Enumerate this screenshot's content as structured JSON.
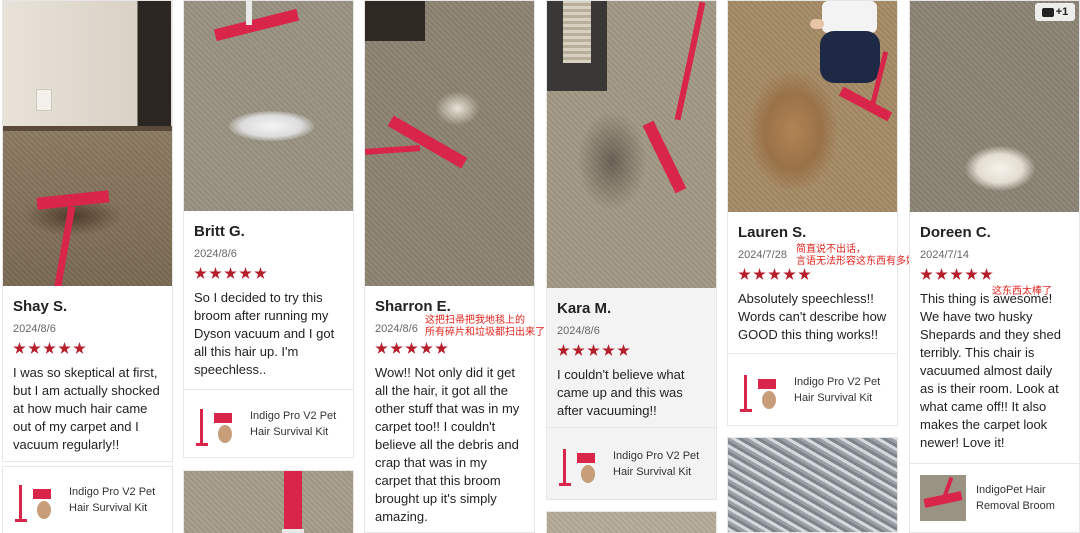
{
  "reviews": [
    {
      "name": "Shay S.",
      "date": "2024/8/6",
      "text": "I was so skeptical at first, but I am actually shocked at how much hair came out of my carpet and I vacuum regularly!!",
      "product": "Indigo Pro V2 Pet Hair Survival Kit",
      "rating": 5
    },
    {
      "name": "Britt G.",
      "date": "2024/8/6",
      "text": "So I decided to try this broom after running my Dyson vacuum and I got all this hair up. I'm speechless..",
      "product": "Indigo Pro V2 Pet Hair Survival Kit",
      "rating": 5
    },
    {
      "name": "Sharron E.",
      "date": "2024/8/6",
      "text": "Wow!! Not only did it get all the hair, it got all the other stuff that was in my carpet too!! I couldn't believe all the debris and crap that was in my carpet that this broom brought up it's simply amazing.",
      "rating": 5
    },
    {
      "name": "Kara M.",
      "date": "2024/8/6",
      "text": "I couldn't believe what came up and this was after vacuuming!!",
      "product": "Indigo Pro V2 Pet Hair Survival Kit",
      "rating": 5
    },
    {
      "name": "Lauren S.",
      "date": "2024/7/28",
      "text": "Absolutely speechless!! Words can't describe how GOOD this thing works!!",
      "product": "Indigo Pro V2 Pet Hair Survival Kit",
      "rating": 5
    },
    {
      "name": "Doreen C.",
      "date": "2024/7/14",
      "text": "This thing is awesome! We have two husky Shepards and they shed terribly. This chair is vacuumed almost daily as is their room. Look at what came off!! It also makes the carpet look newer! Love it!",
      "product": "IndigoPet Hair Removal Broom",
      "rating": 5
    }
  ],
  "annotations": {
    "sharron_line1": "这把扫帚把我地毯上的",
    "sharron_line2": "所有碎片和垃圾都扫出来了",
    "lauren_line1": "简直说不出话，",
    "lauren_line2": "言语无法形容这东西有多好",
    "doreen_line1": "这东西太棒了"
  },
  "badge": {
    "label": "+1"
  },
  "colors": {
    "star": "#b51e2b",
    "annotation": "#e0241c",
    "broom": "#d9254a"
  }
}
